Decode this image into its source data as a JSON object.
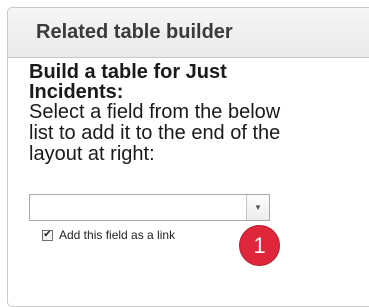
{
  "panel": {
    "title": "Related table builder"
  },
  "builder": {
    "heading_line1": "Build a table for Just",
    "heading_line2": "Incidents:",
    "instruction_line1": "Select a field from the below",
    "instruction_line2": "list to add it to the end of the",
    "instruction_line3": "layout at right:"
  },
  "field_select": {
    "selected_value": "",
    "arrow_icon": "triangle-down-icon"
  },
  "link_checkbox": {
    "checked": true,
    "label": "Add this field as a link"
  },
  "annotation": {
    "number": "1",
    "color": "#e0263a"
  }
}
